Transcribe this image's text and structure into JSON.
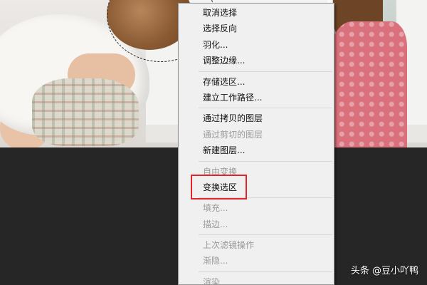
{
  "photo": {
    "description_label": ""
  },
  "context_menu": {
    "groups": [
      {
        "items": [
          {
            "label": "取消选择",
            "enabled": true
          },
          {
            "label": "选择反向",
            "enabled": true
          },
          {
            "label": "羽化...",
            "enabled": true
          },
          {
            "label": "调整边缘...",
            "enabled": true
          }
        ]
      },
      {
        "items": [
          {
            "label": "存储选区...",
            "enabled": true
          },
          {
            "label": "建立工作路径...",
            "enabled": true
          }
        ]
      },
      {
        "items": [
          {
            "label": "通过拷贝的图层",
            "enabled": true
          },
          {
            "label": "通过剪切的图层",
            "enabled": false
          },
          {
            "label": "新建图层...",
            "enabled": true
          }
        ]
      },
      {
        "items": [
          {
            "label": "自由变换",
            "enabled": false
          },
          {
            "label": "变换选区",
            "enabled": true
          }
        ]
      },
      {
        "items": [
          {
            "label": "填充...",
            "enabled": false
          },
          {
            "label": "描边...",
            "enabled": false
          }
        ]
      },
      {
        "items": [
          {
            "label": "上次滤镜操作",
            "enabled": false
          },
          {
            "label": "渐隐...",
            "enabled": false
          }
        ]
      },
      {
        "items": [
          {
            "label": "渲染",
            "enabled": false
          }
        ]
      }
    ],
    "highlighted_item": "变换选区"
  },
  "annotation": {
    "highlight_color": "#e1252b"
  },
  "watermark": {
    "text": "头条 @豆小吖鸭"
  }
}
